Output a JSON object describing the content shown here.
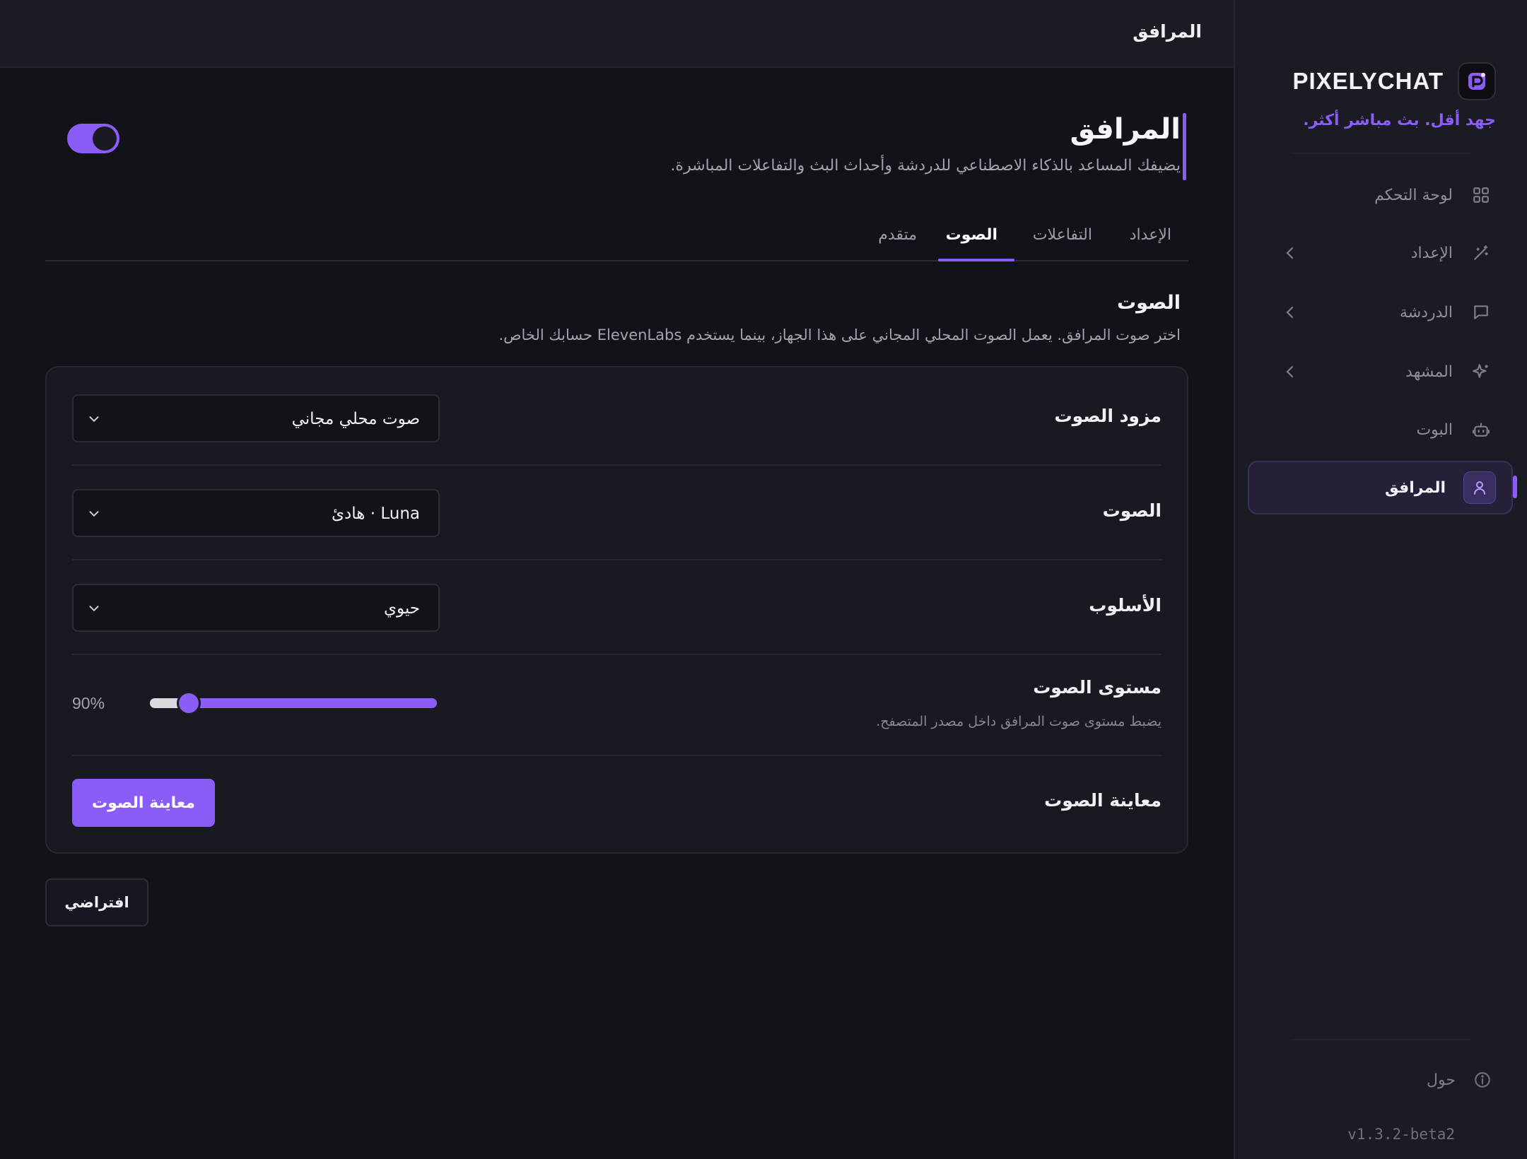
{
  "sidebar": {
    "brand": "PIXELYCHAT",
    "tagline": "جهد أقل. بث مباشر أكثر.",
    "items": [
      {
        "label": "لوحة التحكم"
      },
      {
        "label": "الإعداد"
      },
      {
        "label": "الدردشة"
      },
      {
        "label": "المشهد"
      },
      {
        "label": "البوت"
      },
      {
        "label": "المرافق"
      }
    ],
    "about": "حول",
    "version": "v1.3.2-beta2"
  },
  "topbar": {
    "title": "المرافق"
  },
  "page": {
    "title": "المرافق",
    "subtitle": "يضيفك المساعد بالذكاء الاصطناعي للدردشة وأحداث البث والتفاعلات المباشرة.",
    "enabled": true
  },
  "tabs": [
    {
      "label": "الإعداد",
      "active": false
    },
    {
      "label": "التفاعلات",
      "active": false
    },
    {
      "label": "الصوت",
      "active": true
    },
    {
      "label": "متقدم",
      "active": false
    }
  ],
  "section": {
    "title": "الصوت",
    "description": "اختر صوت المرافق. يعمل الصوت المحلي المجاني على هذا الجهاز، بينما يستخدم ElevenLabs حسابك الخاص."
  },
  "settings": {
    "provider": {
      "label": "مزود الصوت",
      "value": "صوت محلي مجاني"
    },
    "voice": {
      "label": "الصوت",
      "value": "Luna · هادئ"
    },
    "style": {
      "label": "الأسلوب",
      "value": "حيوي"
    },
    "volume": {
      "label": "مستوى الصوت",
      "hint": "يضبط مستوى صوت المرافق داخل مصدر المتصفح.",
      "value_text": "90%",
      "value": 90
    },
    "preview": {
      "label": "معاينة الصوت",
      "button": "معاينة الصوت"
    }
  },
  "footer": {
    "default_button": "افتراضي"
  },
  "colors": {
    "accent": "#8b5cf6",
    "background": "#121318",
    "sidebar": "#1b1c23"
  }
}
